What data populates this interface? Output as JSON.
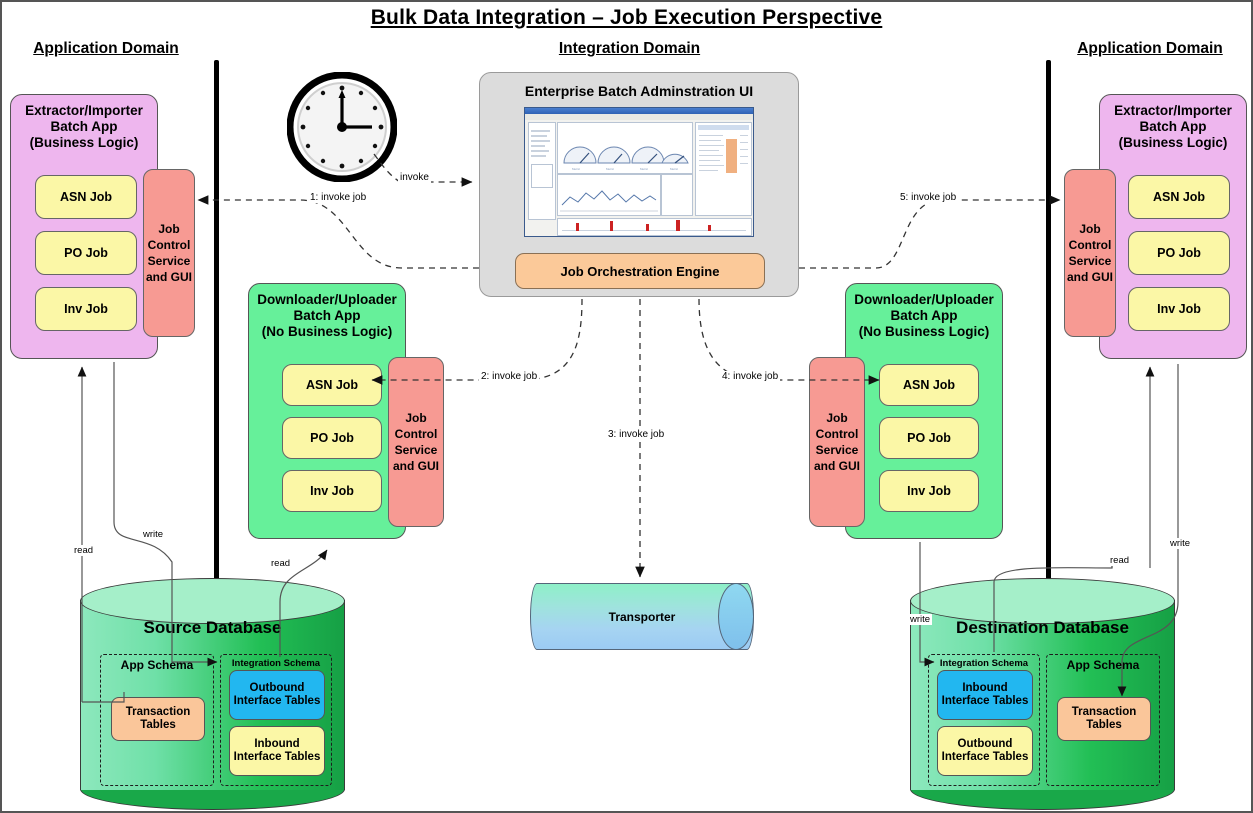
{
  "title": "Bulk Data Integration – Job Execution Perspective",
  "domains": {
    "left": "Application Domain",
    "center": "Integration Domain",
    "right": "Application Domain"
  },
  "integration_panel": {
    "title": "Enterprise Batch Adminstration UI",
    "orchestration_engine": "Job Orchestration Engine"
  },
  "transporter": {
    "label": "Transporter"
  },
  "left_batch_app": {
    "title_line1": "Extractor/Importer",
    "title_line2": "Batch App",
    "title_line3": "(Business Logic)",
    "jobs": [
      "ASN Job",
      "PO Job",
      "Inv Job"
    ],
    "job_control": "Job Control Service and GUI"
  },
  "left_downloader_app": {
    "title_line1": "Downloader/Uploader",
    "title_line2": "Batch App",
    "title_line3": "(No Business Logic)",
    "jobs": [
      "ASN Job",
      "PO Job",
      "Inv Job"
    ],
    "job_control": "Job Control Service and GUI"
  },
  "right_downloader_app": {
    "title_line1": "Downloader/Uploader",
    "title_line2": "Batch App",
    "title_line3": "(No Business Logic)",
    "jobs": [
      "ASN Job",
      "PO Job",
      "Inv Job"
    ],
    "job_control": "Job Control Service and GUI"
  },
  "right_batch_app": {
    "title_line1": "Extractor/Importer",
    "title_line2": "Batch App",
    "title_line3": "(Business Logic)",
    "jobs": [
      "ASN Job",
      "PO Job",
      "Inv Job"
    ],
    "job_control": "Job Control Service and GUI"
  },
  "source_database": {
    "name": "Source Database",
    "app_schema": {
      "name": "App Schema",
      "tables": [
        "Transaction Tables"
      ]
    },
    "integration_schema": {
      "name": "Integration Schema",
      "tables": [
        "Outbound Interface Tables",
        "Inbound Interface Tables"
      ]
    }
  },
  "destination_database": {
    "name": "Destination Database",
    "integration_schema": {
      "name": "Integration Schema",
      "tables": [
        "Inbound Interface Tables",
        "Outbound Interface Tables"
      ]
    },
    "app_schema": {
      "name": "App Schema",
      "tables": [
        "Transaction Tables"
      ]
    }
  },
  "edges": {
    "clock_invoke": "invoke",
    "step1": "1: invoke job",
    "step2": "2: invoke job",
    "step3": "3: invoke job",
    "step4": "4: invoke job",
    "step5": "5: invoke job",
    "src_read_left": "read",
    "src_write": "write",
    "src_read_right": "read",
    "dst_write_left": "write",
    "dst_read": "read",
    "dst_write_right": "write"
  },
  "colors": {
    "pink_app": "#eeb6ee",
    "green_app": "#66f09a",
    "job_yellow": "#fbf7a6",
    "job_control_red": "#f79a93",
    "orchestration_orange": "#fbc999",
    "panel_gray": "#dcdcdc",
    "table_orange": "#fac69a",
    "table_blue": "#22b7f0",
    "db_green": "#22bf55"
  }
}
